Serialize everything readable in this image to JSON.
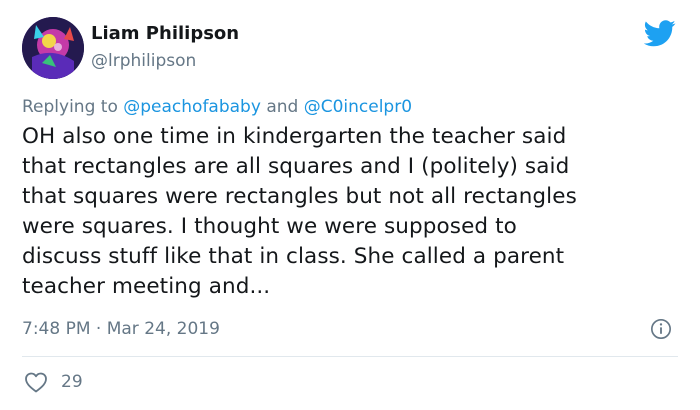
{
  "tweet": {
    "author": {
      "display_name": "Liam Philipson",
      "handle": "@lrphilipson",
      "avatar_icon": "avatar-image"
    },
    "reply": {
      "prefix": "Replying to",
      "mention_1": "@peachofababy",
      "conjunction": "and",
      "mention_2": "@C0incelpr0"
    },
    "body_lines": [
      "OH also one time in kindergarten the teacher said",
      "that rectangles are all squares and I (politely) said",
      "that squares were rectangles but not all rectangles",
      "were squares. I thought we were supposed to",
      "discuss stuff like that in class. She called a parent",
      "teacher meeting and..."
    ],
    "timestamp": "7:48 PM · Mar 24, 2019",
    "like_count": "29",
    "icons": {
      "brand": "twitter-bird-icon",
      "info": "info-icon",
      "like": "heart-icon"
    },
    "colors": {
      "brand_blue": "#1da1f2",
      "mention_blue": "#1b95e0",
      "secondary_text": "#657786",
      "primary_text": "#14171a"
    }
  }
}
